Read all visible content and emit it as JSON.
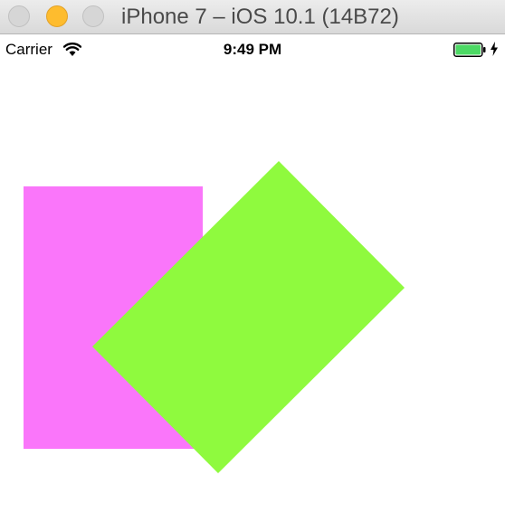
{
  "window": {
    "title": "iPhone 7 – iOS 10.1 (14B72)"
  },
  "statusbar": {
    "carrier": "Carrier",
    "time": "9:49 PM",
    "battery_level": 1.0
  },
  "icons": {
    "wifi": "wifi-icon",
    "battery": "battery-icon",
    "charging": "charging-bolt-icon"
  },
  "colors": {
    "pink": "#fa76fa",
    "green": "#8ffa3e",
    "battery_fill": "#4cd964"
  }
}
